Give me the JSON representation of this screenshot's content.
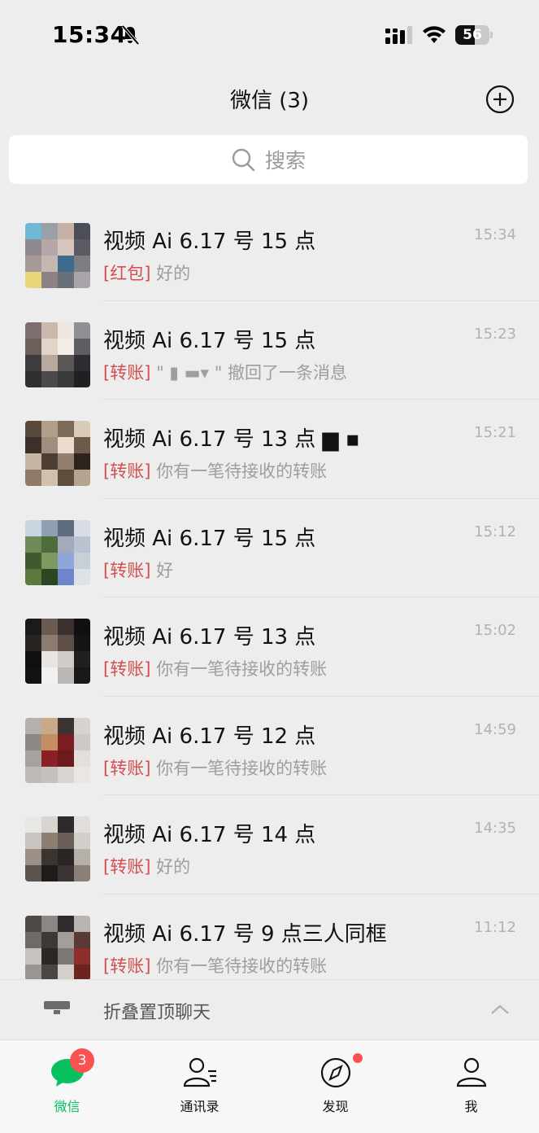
{
  "status_bar": {
    "time": "15:34",
    "battery": "56"
  },
  "header": {
    "title": "微信 (3)"
  },
  "search": {
    "placeholder": "搜索"
  },
  "chats": [
    {
      "name": "视频 Ai 6.17 号 15 点",
      "time": "15:34",
      "tag": "[红包]",
      "text": " 好的",
      "avatar": [
        "#6fb8d6",
        "#9aa0a8",
        "#c7b1a4",
        "#4b4e58",
        "#8e8a90",
        "#b6a6a8",
        "#d7c5bf",
        "#5c5b63",
        "#a79a96",
        "#c4b8b2",
        "#3d6b8c",
        "#7d7d82",
        "#e7d77a",
        "#8d8186",
        "#6b6f7a",
        "#a8a4aa"
      ]
    },
    {
      "name": "视频 Ai 6.17 号 15 点",
      "time": "15:23",
      "tag": "[转账]",
      "text": " \"   ▮          ▬▾ \" 撤回了一条消息",
      "avatar": [
        "#7e6e6e",
        "#c9b9ad",
        "#efe7df",
        "#8d8f93",
        "#6b5e5b",
        "#e2d4c8",
        "#f5eee6",
        "#5d5d63",
        "#3d3b3e",
        "#b8a89e",
        "#5a5658",
        "#2d2d31",
        "#2f2e31",
        "#4b4a4d",
        "#3a393c",
        "#202022"
      ]
    },
    {
      "name": "视频 Ai 6.17 号 13 点  ▆ ▪",
      "time": "15:21",
      "tag": "[转账]",
      "text": " 你有一笔待接收的转账",
      "avatar": [
        "#5a4a3d",
        "#b19f8a",
        "#7c6a59",
        "#d9cbb8",
        "#3d3028",
        "#a08d7c",
        "#e7dccd",
        "#6d5a4a",
        "#c7b6a2",
        "#4d3e33",
        "#927f6d",
        "#2e241d",
        "#8e7a67",
        "#d1c0ab",
        "#5e4d3f",
        "#b6a38f"
      ]
    },
    {
      "name": "视频 Ai 6.17 号 15 点",
      "time": "15:12",
      "tag": "[转账]",
      "text": " 好",
      "avatar": [
        "#c9d6e2",
        "#8ea1b3",
        "#5c6e7d",
        "#d8dde4",
        "#6f8a58",
        "#4e6d3c",
        "#a5a9b8",
        "#b9c4d3",
        "#3e5a2e",
        "#7f9a5f",
        "#8fa6d8",
        "#c7cfd8",
        "#5b7a3d",
        "#2e4522",
        "#6c86c9",
        "#dde2e8"
      ]
    },
    {
      "name": "视频 Ai 6.17 号 13 点",
      "time": "15:02",
      "tag": "[转账]",
      "text": " 你有一笔待接收的转账",
      "avatar": [
        "#1a1a1a",
        "#6b5b52",
        "#3a302d",
        "#101010",
        "#2a2421",
        "#8c7b70",
        "#5e4f46",
        "#151515",
        "#0f0f0f",
        "#e8e4e0",
        "#d0ccc8",
        "#202020",
        "#121212",
        "#f2f0ee",
        "#bdb8b3",
        "#181818"
      ]
    },
    {
      "name": "视频 Ai 6.17 号 12 点",
      "time": "14:59",
      "tag": "[转账]",
      "text": " 你有一笔待接收的转账",
      "avatar": [
        "#b4b0ac",
        "#c9a98a",
        "#3b3431",
        "#d8d3cf",
        "#8f8985",
        "#c58e62",
        "#7a1e22",
        "#cfcac5",
        "#a7a29e",
        "#8b1f26",
        "#6d1a1f",
        "#e4dfda",
        "#bfbab6",
        "#c6c1bc",
        "#d9d4cf",
        "#eae6e2"
      ]
    },
    {
      "name": "视频 Ai 6.17 号 14 点",
      "time": "14:35",
      "tag": "[转账]",
      "text": " 好的",
      "avatar": [
        "#e9e7e4",
        "#d8d5d1",
        "#2c2a2a",
        "#e2dfdb",
        "#c9c5c0",
        "#8d7e73",
        "#6a5f58",
        "#d2cec9",
        "#9b8f86",
        "#3a3533",
        "#2a2625",
        "#b7b0a9",
        "#5d534d",
        "#1f1c1b",
        "#3a3331",
        "#8a8078"
      ]
    },
    {
      "name": "视频 Ai 6.17 号 9 点三人同框",
      "time": "11:12",
      "tag": "[转账]",
      "text": " 你有一笔待接收的转账",
      "avatar": [
        "#4d4a48",
        "#8c8784",
        "#2e2b2a",
        "#b9b4b0",
        "#6f6a67",
        "#3d3938",
        "#a39e9a",
        "#5a3b34",
        "#c7c2be",
        "#2a2727",
        "#7d7874",
        "#8e2d2a",
        "#9a9591",
        "#4a4644",
        "#d4cfcb",
        "#6c2420"
      ]
    }
  ],
  "fold_bar": {
    "label": "折叠置顶聊天"
  },
  "tabs": [
    {
      "label": "微信",
      "badge": "3"
    },
    {
      "label": "通讯录"
    },
    {
      "label": "发现"
    },
    {
      "label": "我"
    }
  ],
  "colors": {
    "accent": "#07c160",
    "tag_red": "#d44f4f",
    "badge_red": "#fa5151",
    "background": "#ededed"
  }
}
